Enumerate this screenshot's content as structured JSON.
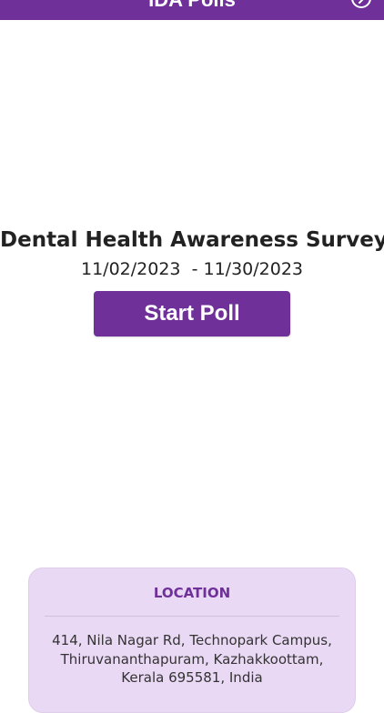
{
  "header": {
    "title": "IDA Polls",
    "action_icon": "chevron-right-circle-icon",
    "background_color": "#6f3099"
  },
  "poll": {
    "title": "Dental Health Awareness Survey",
    "dates": "11/02/2023  - 11/30/2023",
    "start_label": "Start Poll",
    "accent_color": "#6f3099"
  },
  "location": {
    "heading": "LOCATION",
    "address": "414, Nila Nagar Rd, Technopark Campus, Thiruvananthapuram, Kazhakkoottam, Kerala 695581, India",
    "card_color": "#ead9f4"
  }
}
